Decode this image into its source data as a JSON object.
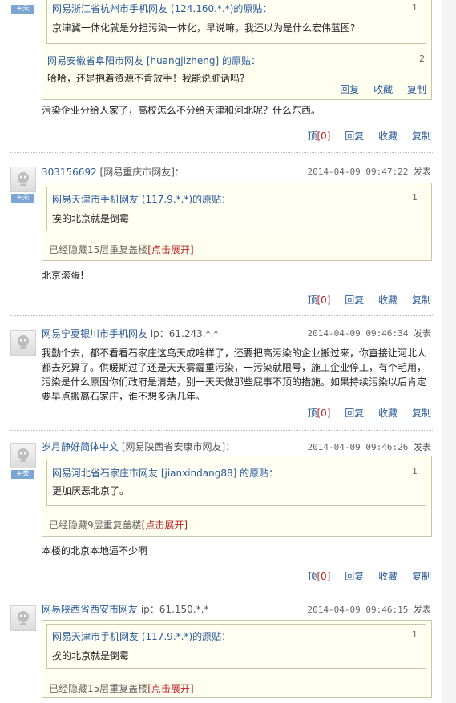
{
  "post0": {
    "follow": "+关",
    "quote1": {
      "author": "网易浙江省杭州市手机网友 (124.160.*.*)的原贴：",
      "num": "1",
      "text": "京津冀一体化就是分担污染一体化，早说嘛，我还以为是什么宏伟蓝图?"
    },
    "quote2": {
      "author": "网易安徽省阜阳市网友 [huangjizheng] 的原贴：",
      "num": "2",
      "text": "哈哈，还是抱着资源不肯放手！我能说脏话吗?"
    },
    "quote_actions": {
      "reply": "回复",
      "fav": "收藏",
      "copy": "复制"
    },
    "content": "污染企业分给人家了，高校怎么不分给天津和河北呢？什么东西。",
    "actions": {
      "up": "顶",
      "up_count": "[0]",
      "reply": "回复",
      "fav": "收藏",
      "copy": "复制"
    }
  },
  "post1": {
    "follow": "+关",
    "user": "303156692",
    "location": "[网易重庆市网友]：",
    "time": "2014-04-09 09:47:22",
    "publish": "发表",
    "quote1": {
      "author": "网易天津市手机网友 (117.9.*.*)的原贴：",
      "num": "1",
      "text": "挨的北京就是倒霉"
    },
    "hidden": "已经隐藏15层重复盖楼",
    "expand": "[点击展开]",
    "content": "北京滚蛋!",
    "actions": {
      "up": "顶",
      "up_count": "[0]",
      "reply": "回复",
      "fav": "收藏",
      "copy": "复制"
    }
  },
  "post2": {
    "user": "网易宁夏银川市手机网友",
    "location": "ip：61.243.*.*",
    "time": "2014-04-09 09:46:34",
    "publish": "发表",
    "content_lines": [
      "我勤个去，都不看看石家庄这鸟天成啥样了，还要把高污染的企业搬过来，你直接让河北人",
      "都去死算了。供暖期过了还是天天雾霾重污染，一污染就限号，施工企业停工，有个毛用，",
      "污染是什么原因你们政府是清楚，别一天天做那些屁事不顶的措施。如果持续污染以后肯定",
      "要早点搬离石家庄，谁不想多活几年。"
    ],
    "actions": {
      "up": "顶",
      "up_count": "[0]",
      "reply": "回复",
      "fav": "收藏",
      "copy": "复制"
    }
  },
  "post3": {
    "follow": "+关",
    "user": "岁月静好简体中文",
    "location": "[网易陕西省安康市网友]：",
    "time": "2014-04-09 09:46:26",
    "publish": "发表",
    "quote1": {
      "author": "网易河北省石家庄市网友 [jianxindang88] 的原贴：",
      "num": "1",
      "text": "更加厌恶北京了。"
    },
    "hidden": "已经隐藏9层重复盖楼",
    "expand": "[点击展开]",
    "content": "本楼的北京本地逼不少啊",
    "actions": {
      "up": "顶",
      "up_count": "[0]",
      "reply": "回复",
      "fav": "收藏",
      "copy": "复制"
    }
  },
  "post4": {
    "user": "网易陕西省西安市网友",
    "location": "ip：61.150.*.*",
    "time": "2014-04-09 09:46:15",
    "publish": "发表",
    "quote1": {
      "author": "网易天津市手机网友 (117.9.*.*)的原贴：",
      "num": "1",
      "text": "挨的北京就是倒霉"
    },
    "hidden": "已经隐藏15层重复盖楼",
    "expand": "[点击展开]"
  }
}
